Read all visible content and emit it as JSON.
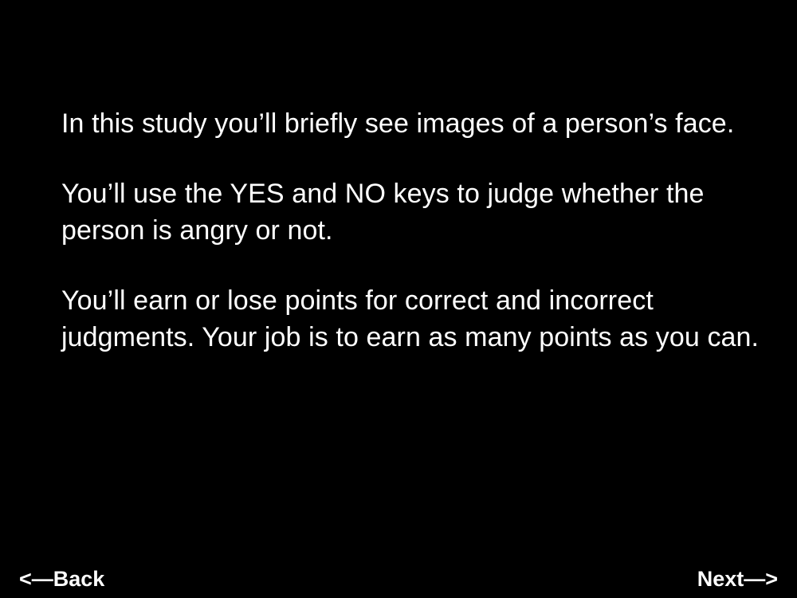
{
  "instructions": {
    "paragraphs": [
      "In this study you’ll briefly see images of a person’s face.",
      "You’ll use the YES and NO keys to judge whether the person is angry or not.",
      "You’ll earn or lose points for correct and incorrect judgments. Your job is to earn as many points as you can."
    ]
  },
  "navigation": {
    "back_label": "<—Back",
    "next_label": "Next—>"
  },
  "colors": {
    "background": "#000000",
    "text": "#ffffff"
  }
}
